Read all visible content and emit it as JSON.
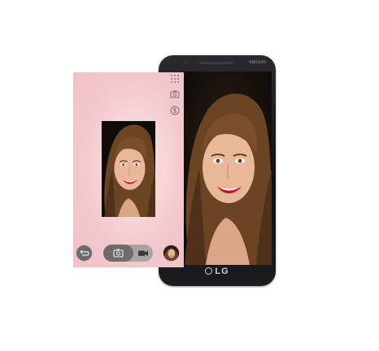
{
  "phone": {
    "carrier_text": "verizon",
    "brand_text": "LG"
  },
  "camera_app": {
    "toolbar": [
      {
        "name": "grid-icon"
      },
      {
        "name": "switch-camera-icon"
      },
      {
        "name": "shot-mode-icon"
      }
    ],
    "bottom_bar": {
      "back": {
        "icon": "back-arrow-icon"
      },
      "modes": [
        {
          "icon": "camera-icon",
          "selected": true
        },
        {
          "icon": "video-camera-icon",
          "selected": false
        }
      ],
      "gallery": {
        "icon": "gallery-thumbnail"
      }
    }
  },
  "colors": {
    "panel_pink": "#f3c8cc",
    "phone_body": "#161618",
    "button_dark": "#6f6b6c",
    "pill_light": "#a9a3a4"
  }
}
